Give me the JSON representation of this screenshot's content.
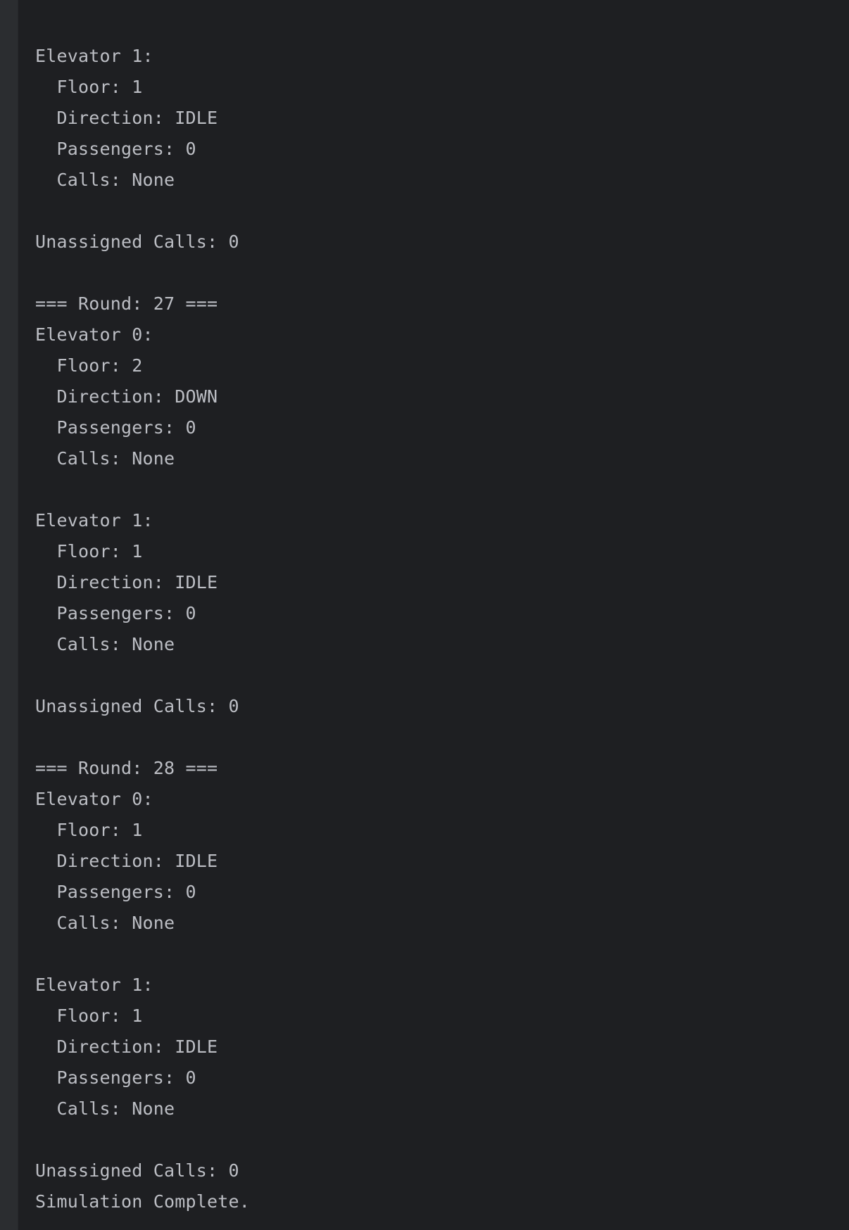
{
  "console": {
    "lines": [
      "Elevator 1:",
      "  Floor: 1",
      "  Direction: IDLE",
      "  Passengers: 0",
      "  Calls: None",
      "",
      "Unassigned Calls: 0",
      "",
      "=== Round: 27 ===",
      "Elevator 0:",
      "  Floor: 2",
      "  Direction: DOWN",
      "  Passengers: 0",
      "  Calls: None",
      "",
      "Elevator 1:",
      "  Floor: 1",
      "  Direction: IDLE",
      "  Passengers: 0",
      "  Calls: None",
      "",
      "Unassigned Calls: 0",
      "",
      "=== Round: 28 ===",
      "Elevator 0:",
      "  Floor: 1",
      "  Direction: IDLE",
      "  Passengers: 0",
      "  Calls: None",
      "",
      "Elevator 1:",
      "  Floor: 1",
      "  Direction: IDLE",
      "  Passengers: 0",
      "  Calls: None",
      "",
      "Unassigned Calls: 0",
      "Simulation Complete."
    ]
  }
}
